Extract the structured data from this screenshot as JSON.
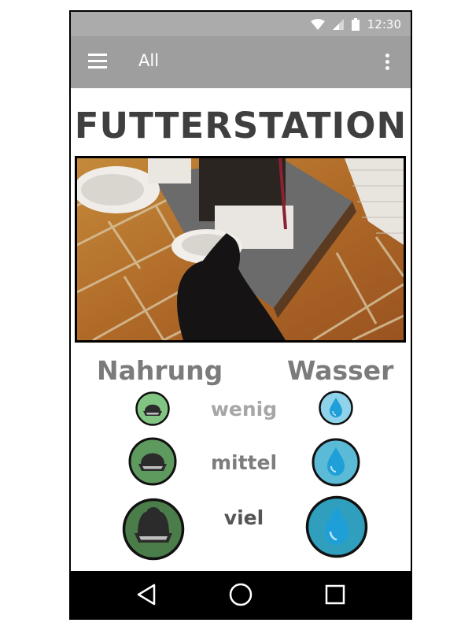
{
  "status_bar": {
    "time": "12:30"
  },
  "app_bar": {
    "title": "All"
  },
  "page": {
    "title": "FUTTERSTATION"
  },
  "columns": {
    "food": "Nahrung",
    "water": "Wasser"
  },
  "levels": [
    {
      "label": "wenig",
      "color": "#a6a6a6"
    },
    {
      "label": "mittel",
      "color": "#7d7d7d"
    },
    {
      "label": "viel",
      "color": "#555555"
    }
  ],
  "colors": {
    "status_bar": "#ababab",
    "app_bar": "#9e9e9e",
    "food_small": "#82c482",
    "food_medium": "#5e9a5e",
    "food_large": "#4b7d4b",
    "water_small": "#8fd3ea",
    "water_medium": "#5bbbd6",
    "water_large": "#2f9fbd"
  },
  "icons": {
    "menu": "hamburger-icon",
    "overflow": "more-vert-icon",
    "back": "back-triangle-icon",
    "home": "home-circle-icon",
    "recents": "recents-square-icon"
  }
}
